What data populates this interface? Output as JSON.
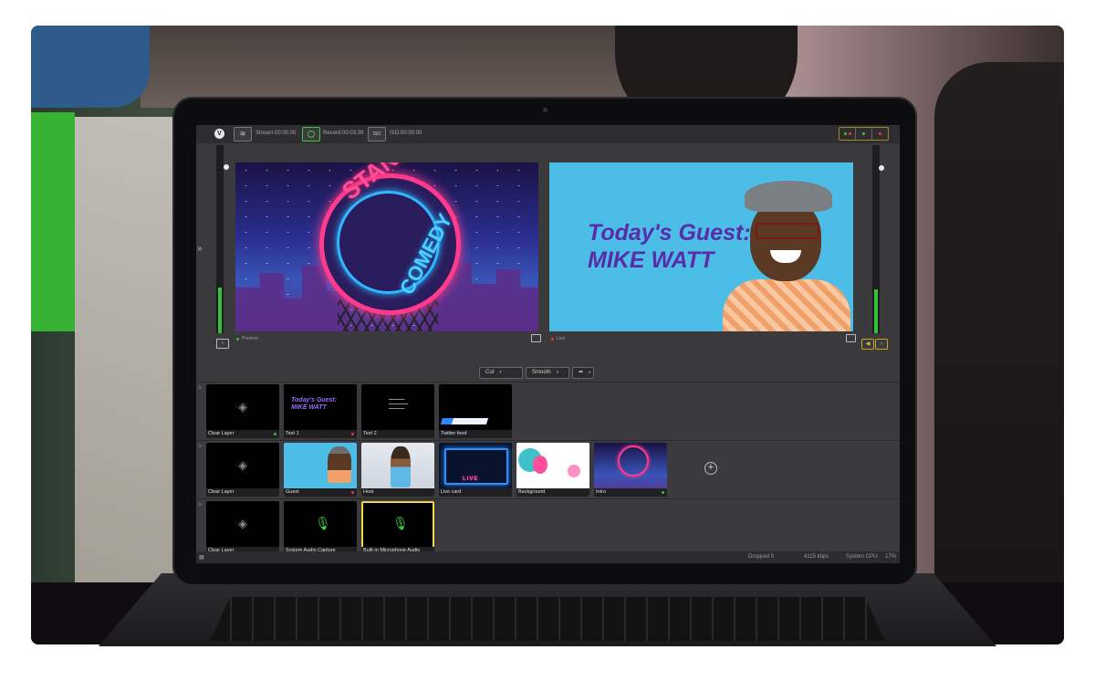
{
  "toolbar": {
    "logo_glyph": "V",
    "stream_label": "Stream:",
    "stream_time": "00:00:00",
    "record_label": "Record:",
    "record_time": "00:03:39",
    "iso_label": "ISO:",
    "iso_time": "00:00:00",
    "iso_button": "ISO"
  },
  "preview": {
    "caption": "Preview",
    "sign_top": "STAND-UP",
    "sign_bottom": "COMEDY"
  },
  "live": {
    "caption": "Live",
    "guest_line1": "Today's Guest:",
    "guest_line2": "MIKE WATT"
  },
  "transitions": {
    "cut": "Cut",
    "smooth": "Smooth",
    "go_arrow": "➡",
    "go_caret": "▸"
  },
  "layers": {
    "row1": [
      {
        "label": "Clear Layer",
        "status": "green"
      },
      {
        "label": "Text 1",
        "status": "red",
        "thumb_line1": "Today's Guest:",
        "thumb_line2": "MIKE WATT"
      },
      {
        "label": "Text 2",
        "status": "none"
      },
      {
        "label": "Twitter feed",
        "status": "none"
      }
    ],
    "row2": [
      {
        "label": "Clear Layer",
        "status": "none"
      },
      {
        "label": "Guest",
        "status": "red"
      },
      {
        "label": "Host",
        "status": "none"
      },
      {
        "label": "Live card",
        "status": "none",
        "thumb_word": "LIVE"
      },
      {
        "label": "Background",
        "status": "none"
      },
      {
        "label": "Intro",
        "status": "green"
      }
    ],
    "row3": [
      {
        "label": "Clear Layer",
        "status": "none"
      },
      {
        "label": "System Audio Capture",
        "status": "none"
      },
      {
        "label": "Built-in Microphone Audio",
        "status": "none",
        "selected": true
      }
    ]
  },
  "status": {
    "dropped": "Dropped 0",
    "bitrate": "4115 kbps",
    "cpu_label": "System CPU:",
    "cpu_value": "17%"
  },
  "colors": {
    "green": "#35c23a",
    "red": "#e23b3b",
    "accent_yellow": "#f2d648"
  }
}
